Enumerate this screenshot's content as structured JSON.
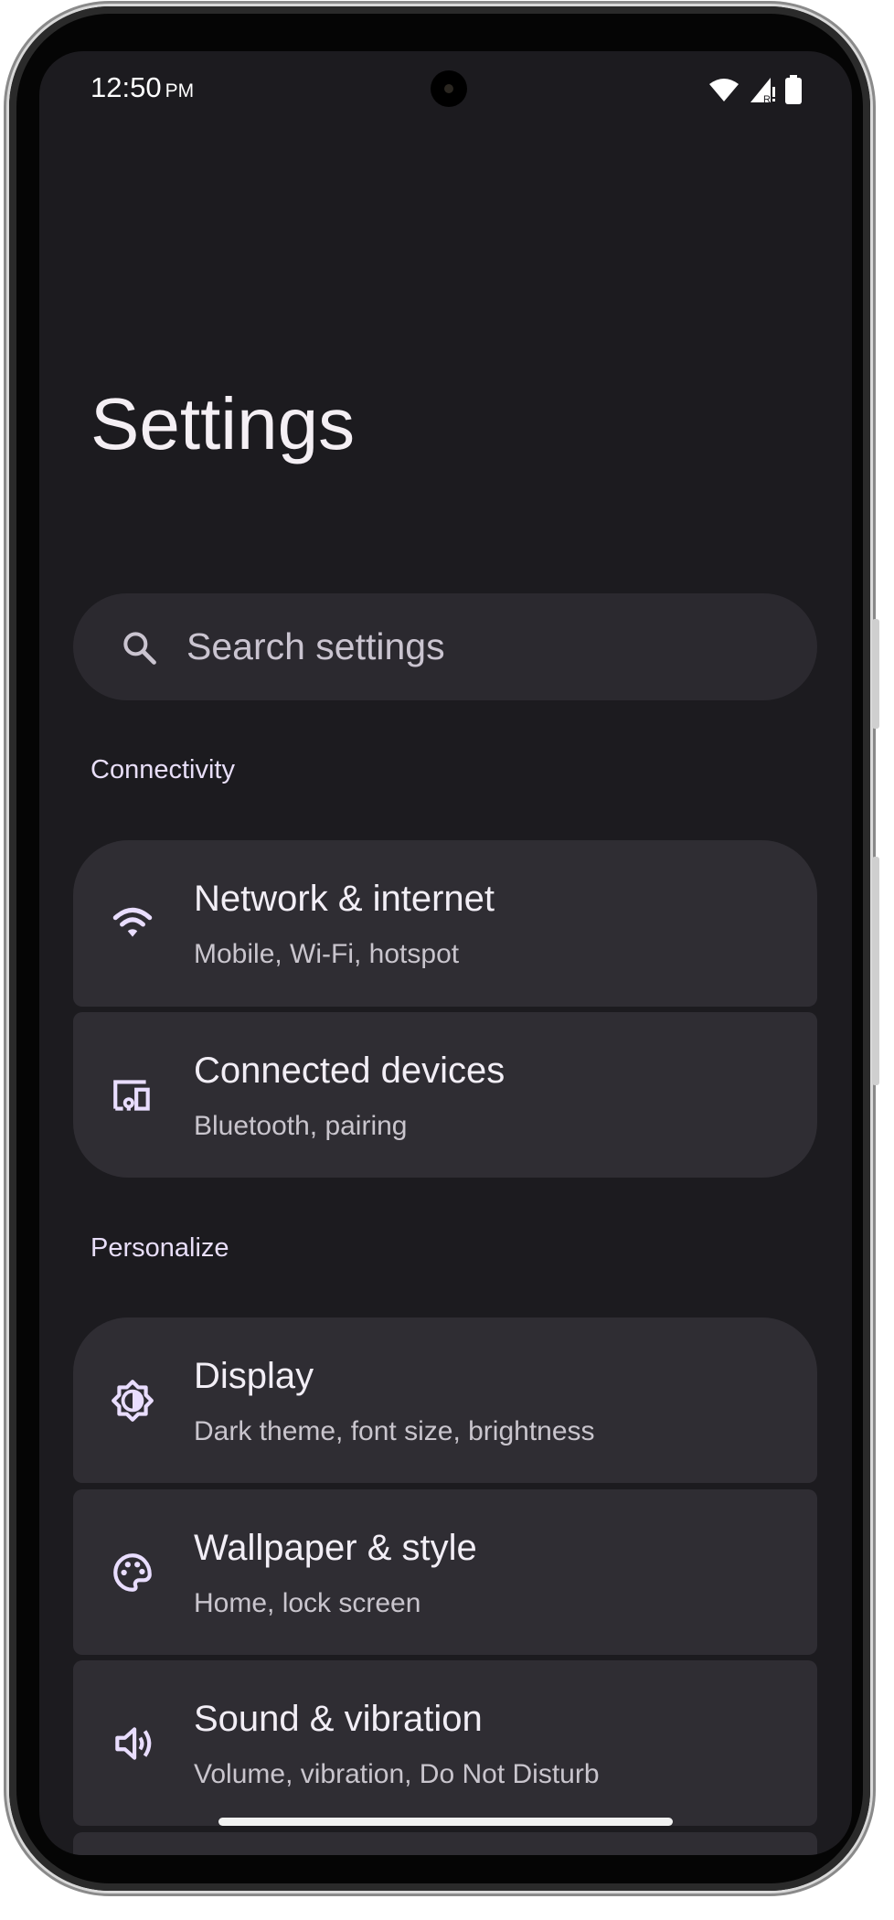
{
  "status_bar": {
    "time": "12:50",
    "ampm": "PM",
    "icons": [
      "wifi-icon",
      "signal-roaming-icon",
      "battery-icon"
    ]
  },
  "header": {
    "title": "Settings"
  },
  "search": {
    "placeholder": "Search settings",
    "icon": "search-icon"
  },
  "sections": [
    {
      "label": "Connectivity",
      "items": [
        {
          "title": "Network & internet",
          "subtitle": "Mobile, Wi-Fi, hotspot",
          "icon": "wifi-icon"
        },
        {
          "title": "Connected devices",
          "subtitle": "Bluetooth, pairing",
          "icon": "devices-icon"
        }
      ]
    },
    {
      "label": "Personalize",
      "items": [
        {
          "title": "Display",
          "subtitle": "Dark theme, font size, brightness",
          "icon": "brightness-icon"
        },
        {
          "title": "Wallpaper & style",
          "subtitle": "Home, lock screen",
          "icon": "palette-icon"
        },
        {
          "title": "Sound & vibration",
          "subtitle": "Volume, vibration, Do Not Disturb",
          "icon": "volume-icon"
        }
      ]
    }
  ],
  "colors": {
    "background": "#1c1b1f",
    "card": "#2f2d33",
    "accent": "#e8def8"
  }
}
